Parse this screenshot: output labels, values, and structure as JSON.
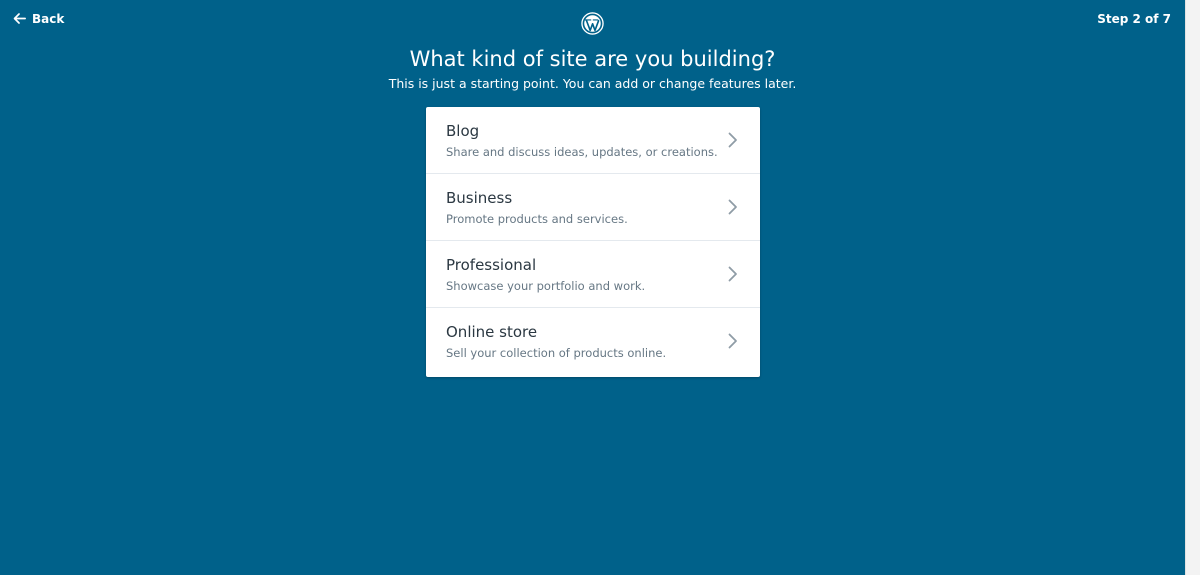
{
  "header": {
    "back_label": "Back",
    "logo_icon": "wordpress-logo-icon",
    "step_label": "Step 2 of 7"
  },
  "main": {
    "title": "What kind of site are you building?",
    "subtitle": "This is just a starting point. You can add or change features later.",
    "options": [
      {
        "title": "Blog",
        "description": "Share and discuss ideas, updates, or creations."
      },
      {
        "title": "Business",
        "description": "Promote products and services."
      },
      {
        "title": "Professional",
        "description": "Showcase your portfolio and work."
      },
      {
        "title": "Online store",
        "description": "Sell your collection of products online."
      }
    ]
  },
  "colors": {
    "background": "#00618a",
    "card": "#ffffff",
    "option_title": "#2b3842",
    "option_description": "#667784",
    "chevron": "#8f9ca6"
  }
}
